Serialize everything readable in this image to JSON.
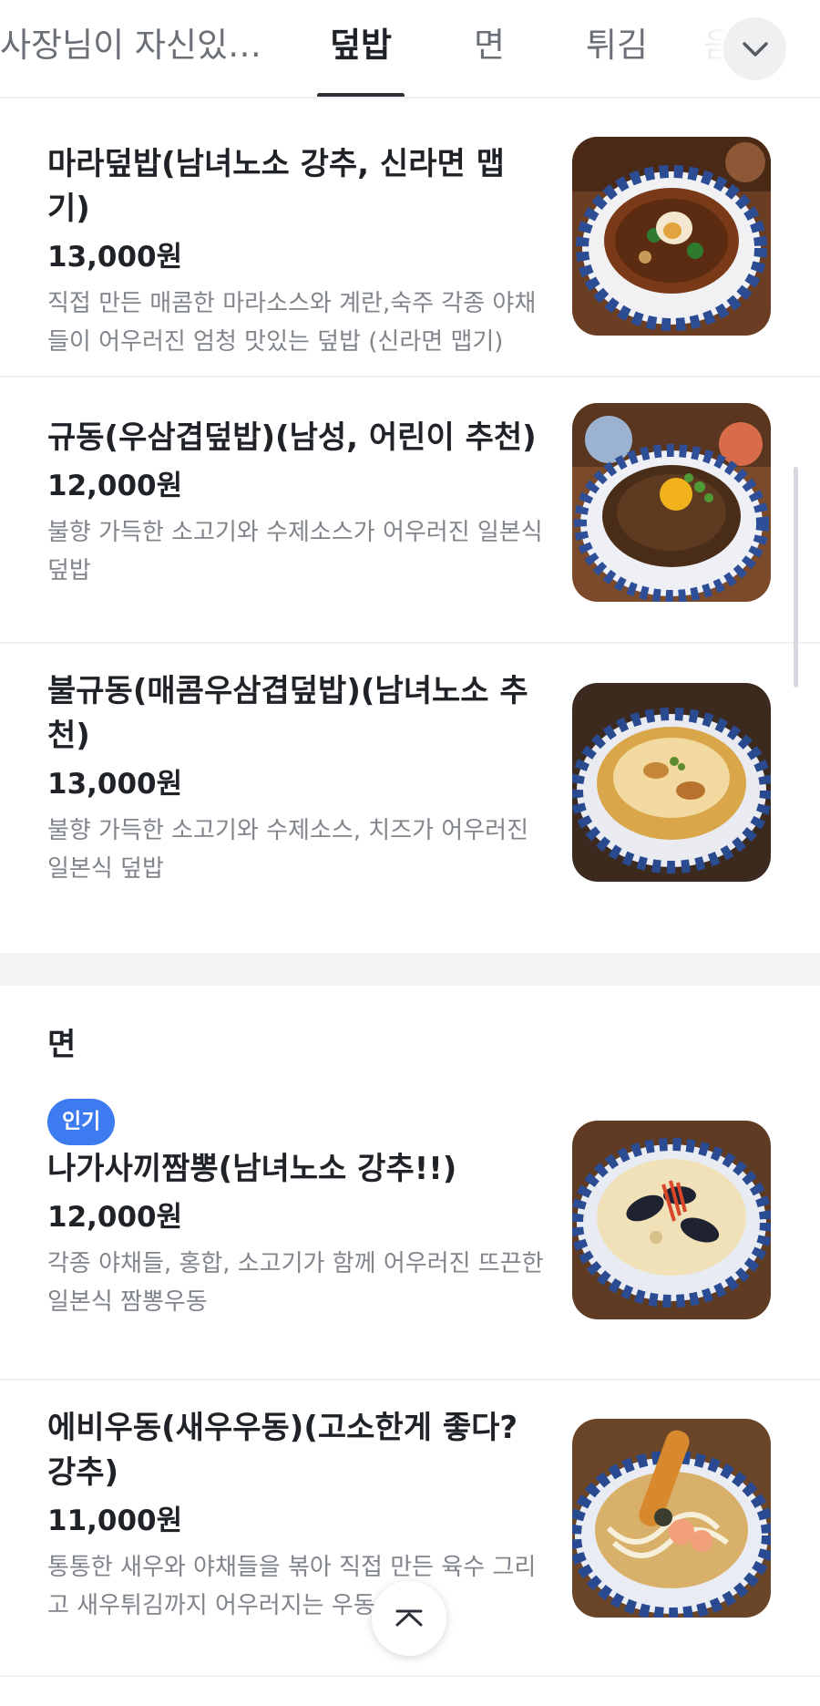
{
  "tabs": [
    {
      "label": "사장님이 자신있는 ...",
      "active": false
    },
    {
      "label": "덮밥",
      "active": true
    },
    {
      "label": "면",
      "active": false
    },
    {
      "label": "튀김",
      "active": false
    },
    {
      "label": "음",
      "active": false
    }
  ],
  "icons": {
    "expand": "chevron-down-icon",
    "scroll_top": "chevron-up-icon"
  },
  "colors": {
    "accent_badge": "#3d7bf1",
    "text_primary": "#1f2328",
    "text_secondary": "#80858c",
    "section_gap": "#f2f4f6"
  },
  "menu_items": [
    {
      "name": "마라덮밥(남녀노소 강추, 신라면 맵기)",
      "price": "13,000원",
      "description": "직접 만든 매콤한 마라소스와 계란,숙주 각종 야채들이 어우러진 엄청 맛있는 덮밥 (신라면 맵기)",
      "photo_icon": "mara-rice-bowl-photo"
    },
    {
      "name": "규동(우삼겹덮밥)(남성, 어린이 추천)",
      "price": "12,000원",
      "description": "불향 가득한 소고기와 수제소스가 어우러진 일본식 덮밥",
      "photo_icon": "gyudon-photo"
    },
    {
      "name": "불규동(매콤우삼겹덮밥)(남녀노소 추천)",
      "price": "13,000원",
      "description": "불향 가득한 소고기와 수제소스, 치즈가 어우러진 일본식 덮밥",
      "photo_icon": "cheese-gyudon-photo"
    }
  ],
  "section": {
    "title": "면"
  },
  "noodle_items": [
    {
      "badge": "인기",
      "name": "나가사끼짬뽕(남녀노소 강추!!)",
      "price": "12,000원",
      "description": "각종 야채들, 홍합, 소고기가 함께 어우러진 뜨끈한 일본식 짬뽕우동",
      "photo_icon": "nagasaki-champon-photo"
    },
    {
      "name": "에비우동(새우우동)(고소한게 좋다? 강추)",
      "price": "11,000원",
      "description": "통통한 새우와 야채들을 볶아 직접 만든 육수 그리고 새우튀김까지 어우러지는 우동",
      "photo_icon": "ebi-udon-photo"
    }
  ]
}
